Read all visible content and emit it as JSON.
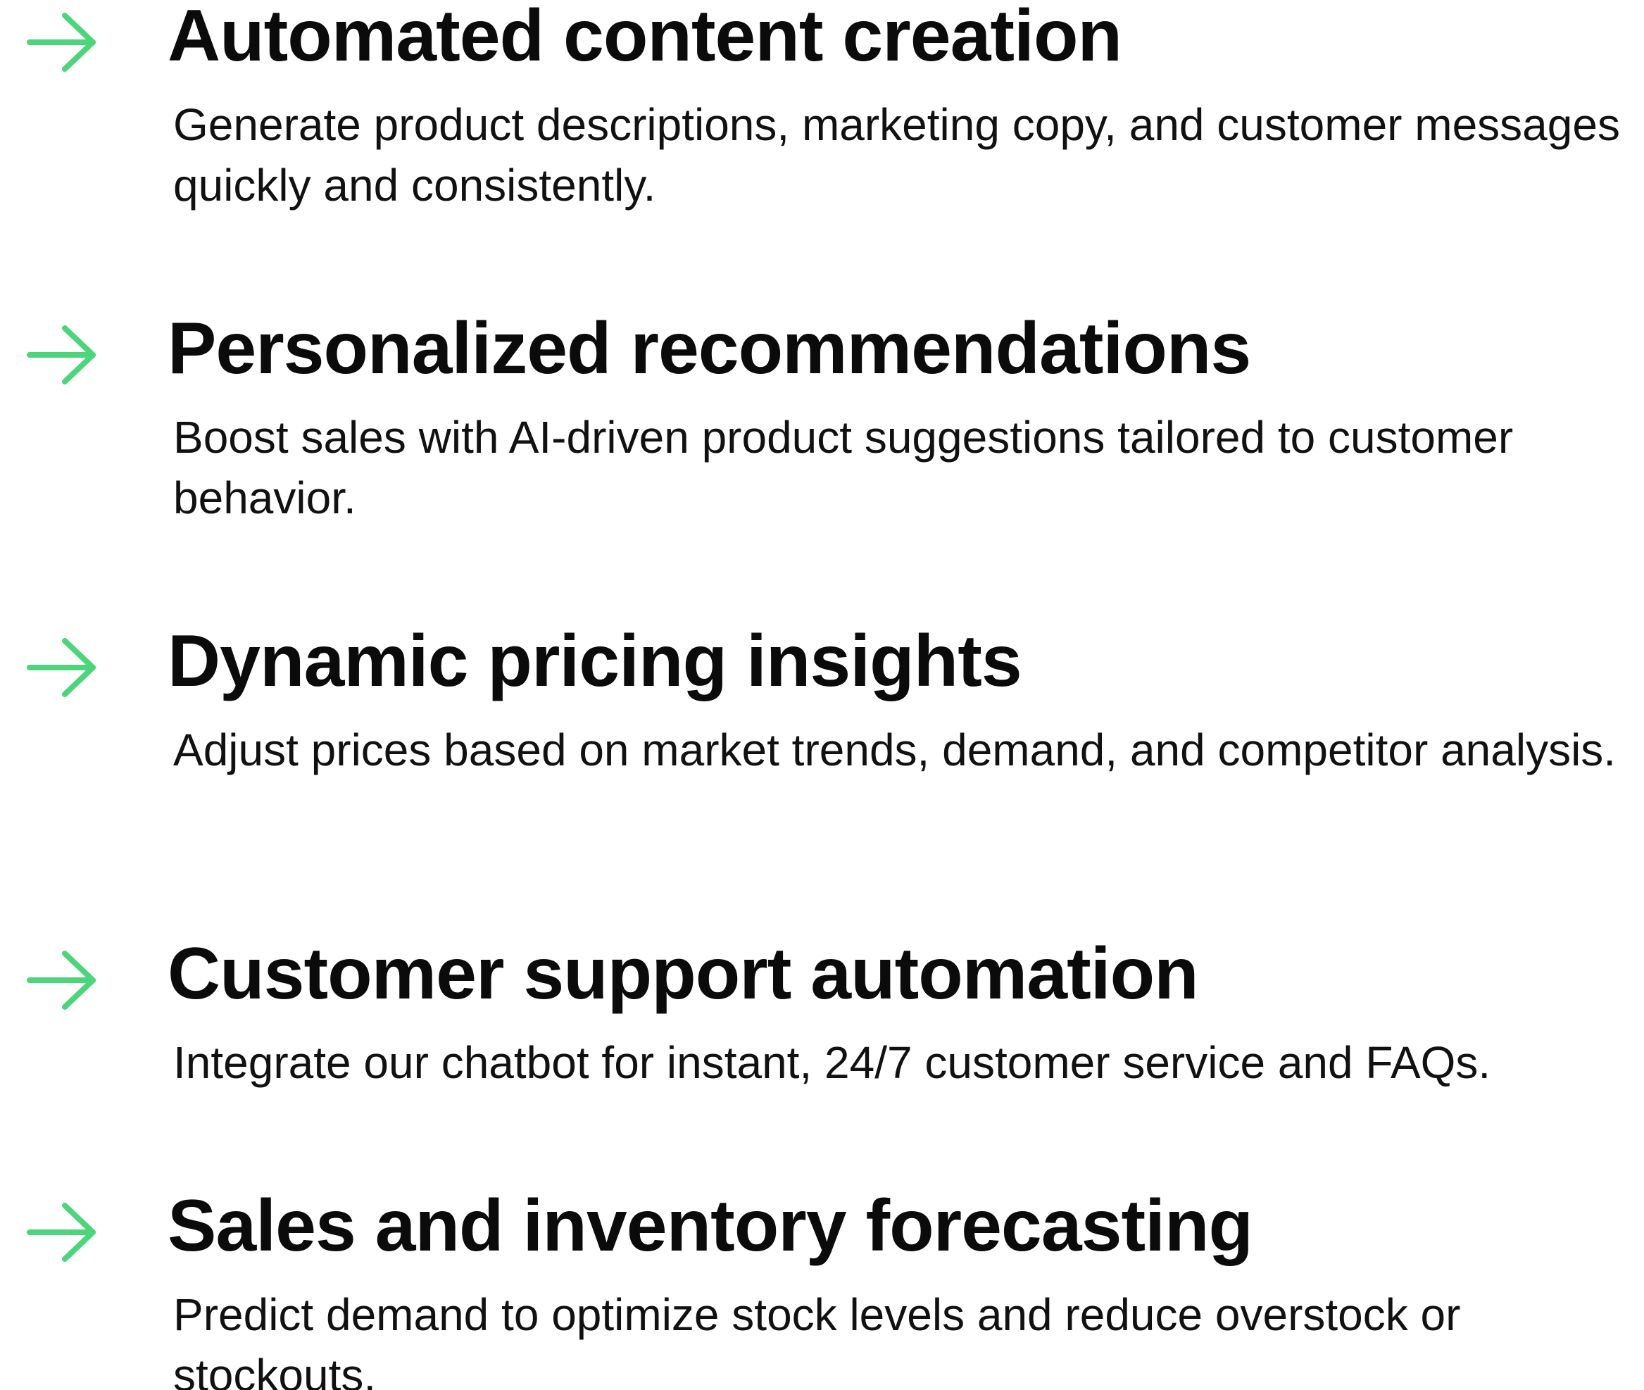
{
  "accent_color": "#4cd57a",
  "features": [
    {
      "icon": "arrow-right-icon",
      "title": "Automated content creation",
      "description": "Generate product descriptions, marketing copy, and customer messages quickly and consistently."
    },
    {
      "icon": "arrow-right-icon",
      "title": "Personalized recommendations",
      "description": "Boost sales with AI-driven product suggestions tailored to customer behavior."
    },
    {
      "icon": "arrow-right-icon",
      "title": "Dynamic pricing insights",
      "description": "Adjust prices based on market trends, demand, and competitor analysis."
    },
    {
      "icon": "arrow-right-icon",
      "title": "Customer support automation",
      "description": "Integrate our chatbot for instant, 24/7 customer service and FAQs."
    },
    {
      "icon": "arrow-right-icon",
      "title": "Sales and inventory forecasting",
      "description": "Predict demand to optimize stock levels and reduce overstock or stockouts."
    }
  ]
}
